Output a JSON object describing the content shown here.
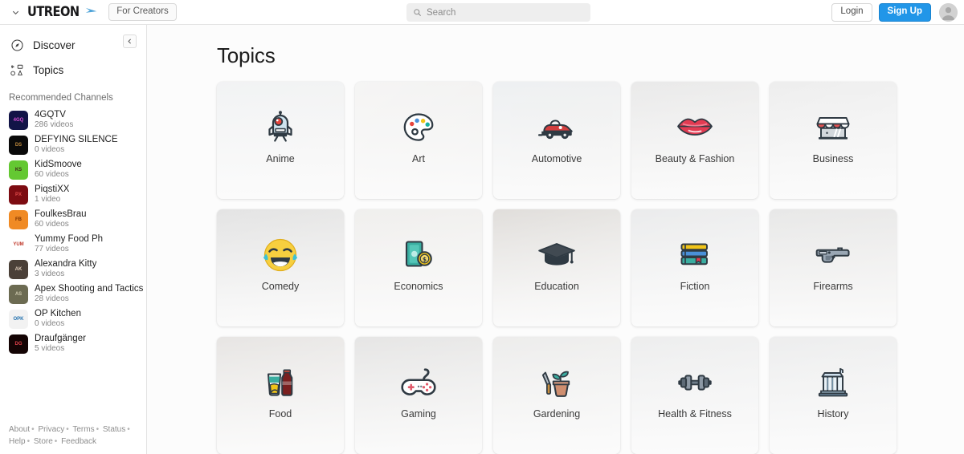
{
  "topbar": {
    "menu_chevron_icon": "chevron-down-icon",
    "brand": "UTREON",
    "brand_arrow_icon": "play-arrow-icon",
    "for_creators_label": "For Creators",
    "search": {
      "placeholder": "Search",
      "value": "",
      "icon": "search-icon"
    },
    "login_label": "Login",
    "signup_label": "Sign Up",
    "avatar_icon": "user-avatar-icon"
  },
  "sidebar": {
    "collapse_icon": "chevron-left-icon",
    "nav": [
      {
        "label": "Discover",
        "icon": "compass-icon",
        "active": false
      },
      {
        "label": "Topics",
        "icon": "topics-grid-icon",
        "active": true
      }
    ],
    "recommended_title": "Recommended Channels",
    "channels": [
      {
        "name": "4GQTV",
        "count": "286 videos",
        "avatar_bg": "#121447",
        "avatar_fg": "#d94fd4",
        "initials": "4GQ"
      },
      {
        "name": "DEFYING SILENCE",
        "count": "0 videos",
        "avatar_bg": "#0a0a0a",
        "avatar_fg": "#c08a3e",
        "initials": "DS"
      },
      {
        "name": "KidSmoove",
        "count": "60 videos",
        "avatar_bg": "#64c832",
        "avatar_fg": "#3b2a18",
        "initials": "KS"
      },
      {
        "name": "PiqstiXX",
        "count": "1 video",
        "avatar_bg": "#7d0c12",
        "avatar_fg": "#e04a4a",
        "initials": "PX"
      },
      {
        "name": "FoulkesBrau",
        "count": "60 videos",
        "avatar_bg": "#f08a24",
        "avatar_fg": "#7b3200",
        "initials": "FB"
      },
      {
        "name": "Yummy Food Ph",
        "count": "77 videos",
        "avatar_bg": "#ffffff",
        "avatar_fg": "#c0392b",
        "initials": "YUM"
      },
      {
        "name": "Alexandra Kitty",
        "count": "3 videos",
        "avatar_bg": "#4b4038",
        "avatar_fg": "#e0cdbb",
        "initials": "AK"
      },
      {
        "name": "Apex Shooting and Tactics",
        "count": "28 videos",
        "avatar_bg": "#6c6b52",
        "avatar_fg": "#cfcbb0",
        "initials": "AS"
      },
      {
        "name": "OP Kitchen",
        "count": "0 videos",
        "avatar_bg": "#f2f2f2",
        "avatar_fg": "#1f6fae",
        "initials": "OPK"
      },
      {
        "name": "Draufgänger",
        "count": "5 videos",
        "avatar_bg": "#140404",
        "avatar_fg": "#e3424a",
        "initials": "DG"
      }
    ],
    "footer_links_row1": [
      "About",
      "Privacy",
      "Terms",
      "Status"
    ],
    "footer_links_row2": [
      "Help",
      "Store",
      "Feedback"
    ],
    "footer_separator": "•"
  },
  "main": {
    "title": "Topics",
    "topics": [
      {
        "label": "Anime",
        "icon": "robot-icon",
        "bg_from": "#cfe1ef",
        "bg_to": "#e8e2dc"
      },
      {
        "label": "Art",
        "icon": "palette-icon",
        "bg_from": "#ece7df",
        "bg_to": "#d9d2c6"
      },
      {
        "label": "Automotive",
        "icon": "convertible-car-icon",
        "bg_from": "#bcd6ea",
        "bg_to": "#ded3c4"
      },
      {
        "label": "Beauty & Fashion",
        "icon": "lips-icon",
        "bg_from": "#b8b6b4",
        "bg_to": "#d8d6d2"
      },
      {
        "label": "Business",
        "icon": "storefront-icon",
        "bg_from": "#c8c8c8",
        "bg_to": "#e4e4e4"
      },
      {
        "label": "Comedy",
        "icon": "laughing-face-icon",
        "bg_from": "#9c9c9c",
        "bg_to": "#c9c4bb"
      },
      {
        "label": "Economics",
        "icon": "money-coins-icon",
        "bg_from": "#d8cdbc",
        "bg_to": "#e6ddcd"
      },
      {
        "label": "Education",
        "icon": "graduation-cap-icon",
        "bg_from": "#9c7f5e",
        "bg_to": "#d7ccbd"
      },
      {
        "label": "Fiction",
        "icon": "books-icon",
        "bg_from": "#b7bec7",
        "bg_to": "#e0e0e0"
      },
      {
        "label": "Firearms",
        "icon": "pistol-icon",
        "bg_from": "#b0b0ae",
        "bg_to": "#cfc4b2"
      },
      {
        "label": "Food",
        "icon": "food-drink-icon",
        "bg_from": "#b8a08c",
        "bg_to": "#ddd2c6"
      },
      {
        "label": "Gaming",
        "icon": "game-controller-icon",
        "bg_from": "#a8a49e",
        "bg_to": "#cfcbc2"
      },
      {
        "label": "Gardening",
        "icon": "potted-plant-icon",
        "bg_from": "#c6c2b8",
        "bg_to": "#e4e2dc"
      },
      {
        "label": "Health & Fitness",
        "icon": "dumbbell-icon",
        "bg_from": "#c4c8cc",
        "bg_to": "#e2e4e6"
      },
      {
        "label": "History",
        "icon": "classical-building-icon",
        "bg_from": "#c2c6cb",
        "bg_to": "#e3e5e7"
      }
    ]
  },
  "colors": {
    "accent": "#2196e8",
    "page_bg": "#fcfcfc",
    "border": "#e2e2e2",
    "text": "#1d1d1d",
    "muted": "#868686"
  }
}
